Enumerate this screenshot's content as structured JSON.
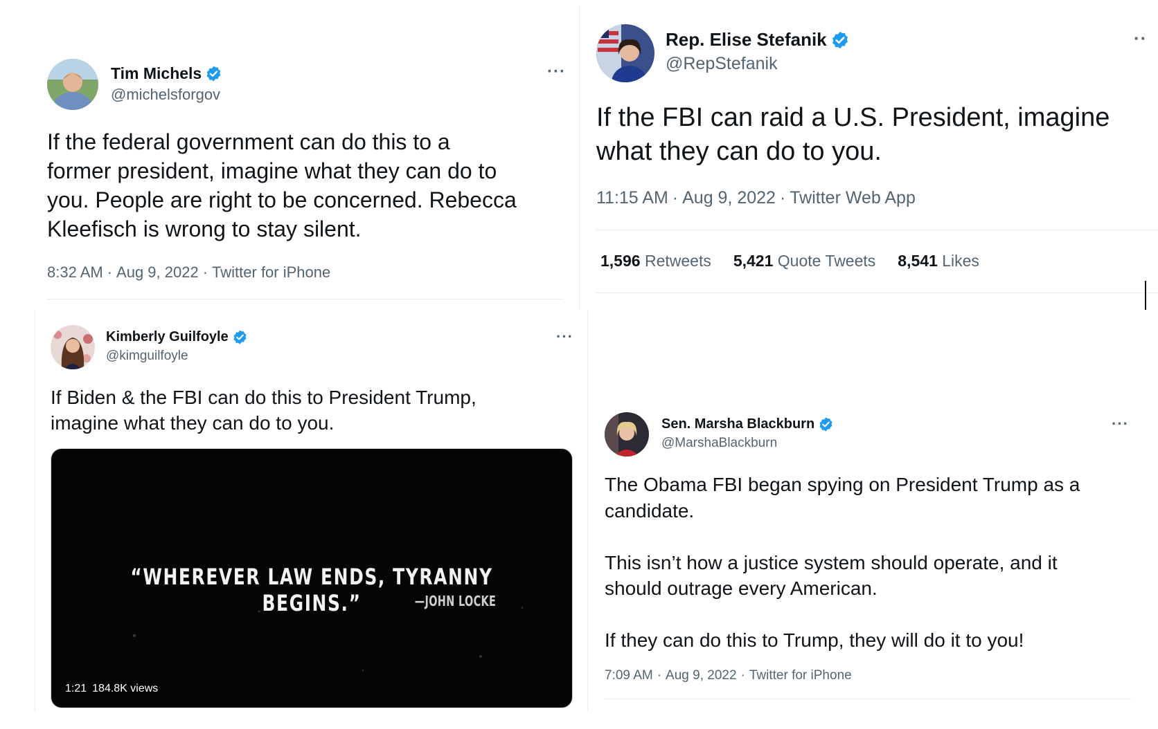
{
  "colors": {
    "verified": "#1d9bf0",
    "secondary_text": "#536471",
    "primary_text": "#0f1419",
    "divider": "#e6ecf0",
    "video_bg": "#050505"
  },
  "tweets": {
    "michels": {
      "name": "Tim Michels",
      "handle": "@michelsforgov",
      "text": "If the federal government can do this to a\nformer president, imagine what they can do to\nyou. People are right to be concerned. Rebecca\nKleefisch is wrong to stay silent.",
      "time": "8:32 AM",
      "date": "Aug 9, 2022",
      "source": "Twitter for iPhone",
      "more": "···"
    },
    "stefanik": {
      "name": "Rep. Elise Stefanik",
      "handle": "@RepStefanik",
      "text": "If the FBI can raid a U.S. President, imagine\nwhat they can do to you.",
      "time": "11:15 AM",
      "date": "Aug 9, 2022",
      "source": "Twitter Web App",
      "more": "··",
      "stats": {
        "retweets_num": "1,596",
        "retweets_label": "Retweets",
        "quotes_num": "5,421",
        "quotes_label": "Quote Tweets",
        "likes_num": "8,541",
        "likes_label": "Likes"
      }
    },
    "guilfoyle": {
      "name": "Kimberly Guilfoyle",
      "handle": "@kimguilfoyle",
      "text": "If Biden & the FBI can do this to President Trump,\nimagine what they can do to you.",
      "more": "···",
      "video": {
        "quote": "“WHEREVER LAW ENDS, TYRANNY BEGINS.”",
        "attribution": "—JOHN LOCKE",
        "duration": "1:21",
        "views": "184.8K views"
      }
    },
    "blackburn": {
      "name": "Sen. Marsha Blackburn",
      "handle": "@MarshaBlackburn",
      "text": "The Obama FBI began spying on President Trump as a\ncandidate.\n\nThis isn’t how a justice system should operate, and it\nshould outrage every American.\n\nIf they can do this to Trump, they will do it to you!",
      "time": "7:09 AM",
      "date": "Aug 9, 2022",
      "source": "Twitter for iPhone",
      "more": "···"
    }
  },
  "icons": {
    "verified": "verified-badge-icon",
    "more": "more-horizontal-icon"
  }
}
